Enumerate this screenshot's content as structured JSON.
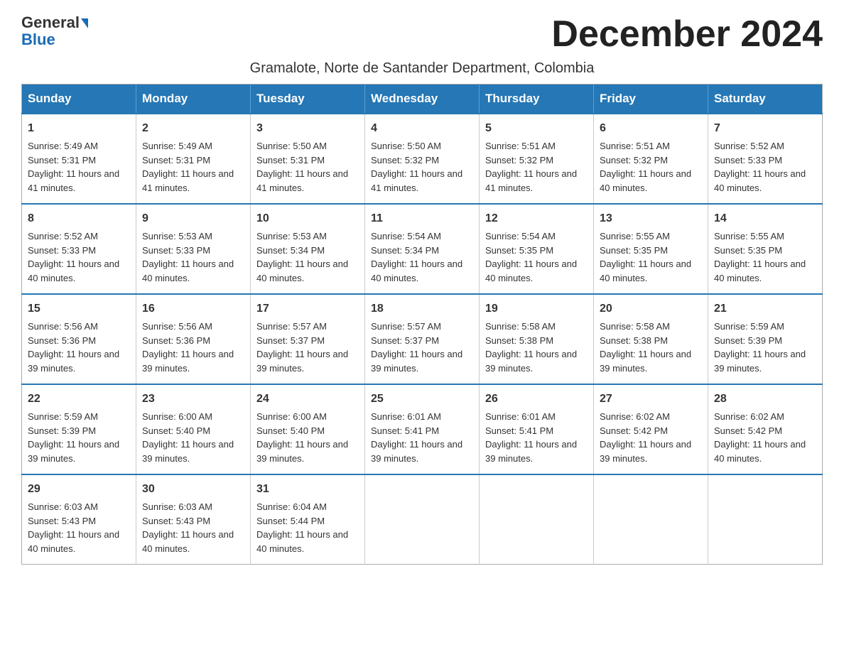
{
  "header": {
    "logo_general": "General",
    "logo_blue": "Blue",
    "month_title": "December 2024",
    "subtitle": "Gramalote, Norte de Santander Department, Colombia"
  },
  "days_of_week": [
    "Sunday",
    "Monday",
    "Tuesday",
    "Wednesday",
    "Thursday",
    "Friday",
    "Saturday"
  ],
  "weeks": [
    [
      {
        "day": "1",
        "sunrise": "5:49 AM",
        "sunset": "5:31 PM",
        "daylight": "11 hours and 41 minutes."
      },
      {
        "day": "2",
        "sunrise": "5:49 AM",
        "sunset": "5:31 PM",
        "daylight": "11 hours and 41 minutes."
      },
      {
        "day": "3",
        "sunrise": "5:50 AM",
        "sunset": "5:31 PM",
        "daylight": "11 hours and 41 minutes."
      },
      {
        "day": "4",
        "sunrise": "5:50 AM",
        "sunset": "5:32 PM",
        "daylight": "11 hours and 41 minutes."
      },
      {
        "day": "5",
        "sunrise": "5:51 AM",
        "sunset": "5:32 PM",
        "daylight": "11 hours and 41 minutes."
      },
      {
        "day": "6",
        "sunrise": "5:51 AM",
        "sunset": "5:32 PM",
        "daylight": "11 hours and 40 minutes."
      },
      {
        "day": "7",
        "sunrise": "5:52 AM",
        "sunset": "5:33 PM",
        "daylight": "11 hours and 40 minutes."
      }
    ],
    [
      {
        "day": "8",
        "sunrise": "5:52 AM",
        "sunset": "5:33 PM",
        "daylight": "11 hours and 40 minutes."
      },
      {
        "day": "9",
        "sunrise": "5:53 AM",
        "sunset": "5:33 PM",
        "daylight": "11 hours and 40 minutes."
      },
      {
        "day": "10",
        "sunrise": "5:53 AM",
        "sunset": "5:34 PM",
        "daylight": "11 hours and 40 minutes."
      },
      {
        "day": "11",
        "sunrise": "5:54 AM",
        "sunset": "5:34 PM",
        "daylight": "11 hours and 40 minutes."
      },
      {
        "day": "12",
        "sunrise": "5:54 AM",
        "sunset": "5:35 PM",
        "daylight": "11 hours and 40 minutes."
      },
      {
        "day": "13",
        "sunrise": "5:55 AM",
        "sunset": "5:35 PM",
        "daylight": "11 hours and 40 minutes."
      },
      {
        "day": "14",
        "sunrise": "5:55 AM",
        "sunset": "5:35 PM",
        "daylight": "11 hours and 40 minutes."
      }
    ],
    [
      {
        "day": "15",
        "sunrise": "5:56 AM",
        "sunset": "5:36 PM",
        "daylight": "11 hours and 39 minutes."
      },
      {
        "day": "16",
        "sunrise": "5:56 AM",
        "sunset": "5:36 PM",
        "daylight": "11 hours and 39 minutes."
      },
      {
        "day": "17",
        "sunrise": "5:57 AM",
        "sunset": "5:37 PM",
        "daylight": "11 hours and 39 minutes."
      },
      {
        "day": "18",
        "sunrise": "5:57 AM",
        "sunset": "5:37 PM",
        "daylight": "11 hours and 39 minutes."
      },
      {
        "day": "19",
        "sunrise": "5:58 AM",
        "sunset": "5:38 PM",
        "daylight": "11 hours and 39 minutes."
      },
      {
        "day": "20",
        "sunrise": "5:58 AM",
        "sunset": "5:38 PM",
        "daylight": "11 hours and 39 minutes."
      },
      {
        "day": "21",
        "sunrise": "5:59 AM",
        "sunset": "5:39 PM",
        "daylight": "11 hours and 39 minutes."
      }
    ],
    [
      {
        "day": "22",
        "sunrise": "5:59 AM",
        "sunset": "5:39 PM",
        "daylight": "11 hours and 39 minutes."
      },
      {
        "day": "23",
        "sunrise": "6:00 AM",
        "sunset": "5:40 PM",
        "daylight": "11 hours and 39 minutes."
      },
      {
        "day": "24",
        "sunrise": "6:00 AM",
        "sunset": "5:40 PM",
        "daylight": "11 hours and 39 minutes."
      },
      {
        "day": "25",
        "sunrise": "6:01 AM",
        "sunset": "5:41 PM",
        "daylight": "11 hours and 39 minutes."
      },
      {
        "day": "26",
        "sunrise": "6:01 AM",
        "sunset": "5:41 PM",
        "daylight": "11 hours and 39 minutes."
      },
      {
        "day": "27",
        "sunrise": "6:02 AM",
        "sunset": "5:42 PM",
        "daylight": "11 hours and 39 minutes."
      },
      {
        "day": "28",
        "sunrise": "6:02 AM",
        "sunset": "5:42 PM",
        "daylight": "11 hours and 40 minutes."
      }
    ],
    [
      {
        "day": "29",
        "sunrise": "6:03 AM",
        "sunset": "5:43 PM",
        "daylight": "11 hours and 40 minutes."
      },
      {
        "day": "30",
        "sunrise": "6:03 AM",
        "sunset": "5:43 PM",
        "daylight": "11 hours and 40 minutes."
      },
      {
        "day": "31",
        "sunrise": "6:04 AM",
        "sunset": "5:44 PM",
        "daylight": "11 hours and 40 minutes."
      },
      null,
      null,
      null,
      null
    ]
  ],
  "labels": {
    "sunrise": "Sunrise:",
    "sunset": "Sunset:",
    "daylight": "Daylight:"
  }
}
